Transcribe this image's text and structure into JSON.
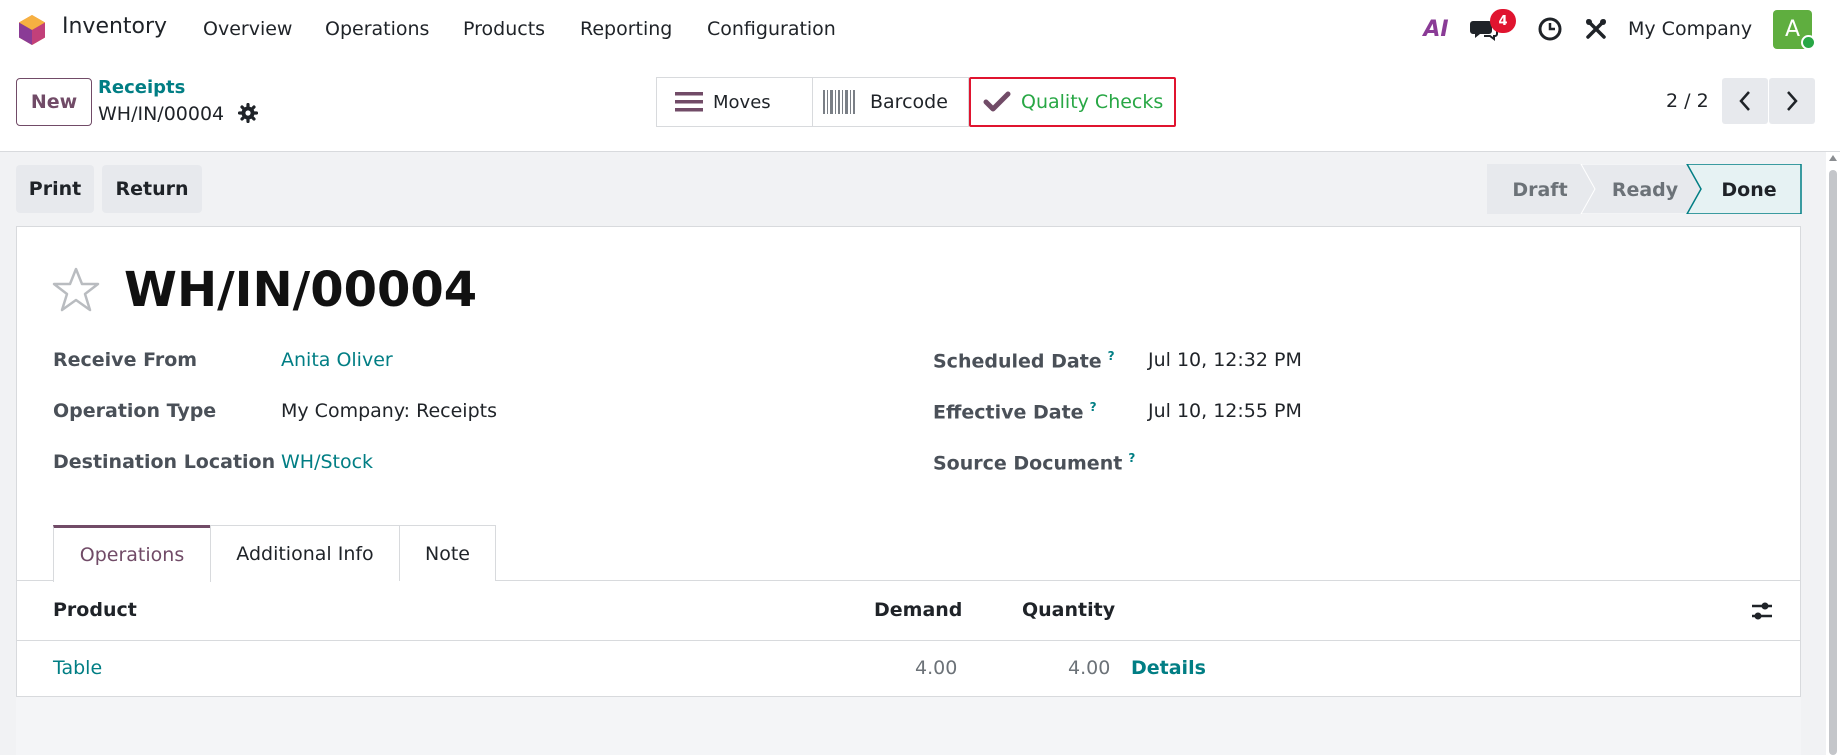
{
  "navbar": {
    "app_name": "Inventory",
    "menus": [
      "Overview",
      "Operations",
      "Products",
      "Reporting",
      "Configuration"
    ],
    "ai_label": "AI",
    "messages_badge": "4",
    "company": "My Company",
    "avatar_initial": "A"
  },
  "control_panel": {
    "new_label": "New",
    "breadcrumb_parent": "Receipts",
    "breadcrumb_current": "WH/IN/00004",
    "smart_buttons": [
      {
        "label": "Moves",
        "icon": "list-icon"
      },
      {
        "label": "Barcode",
        "icon": "barcode-icon"
      },
      {
        "label": "Quality Checks",
        "icon": "check-icon"
      }
    ],
    "pager": "2 / 2"
  },
  "actions": {
    "print": "Print",
    "return": "Return"
  },
  "status": {
    "stages": [
      "Draft",
      "Ready",
      "Done"
    ],
    "current": "Done"
  },
  "record": {
    "title": "WH/IN/00004",
    "left_fields": [
      {
        "label": "Receive From",
        "value": "Anita Oliver"
      },
      {
        "label": "Operation Type",
        "value": "My Company: Receipts"
      },
      {
        "label": "Destination Location",
        "value": "WH/Stock"
      }
    ],
    "right_fields": [
      {
        "label": "Scheduled Date",
        "value": "Jul 10, 12:32 PM"
      },
      {
        "label": "Effective Date",
        "value": "Jul 10, 12:55 PM"
      },
      {
        "label": "Source Document",
        "value": ""
      }
    ],
    "help_mark": "?"
  },
  "tabs": [
    "Operations",
    "Additional Info",
    "Note"
  ],
  "table": {
    "headers": {
      "product": "Product",
      "demand": "Demand",
      "quantity": "Quantity"
    },
    "rows": [
      {
        "product": "Table",
        "demand": "4.00",
        "quantity": "4.00",
        "details": "Details"
      }
    ]
  },
  "colors": {
    "brand": "#714b67",
    "link": "#017e84",
    "highlight": "#e0142f",
    "quality_green": "#28a745"
  }
}
